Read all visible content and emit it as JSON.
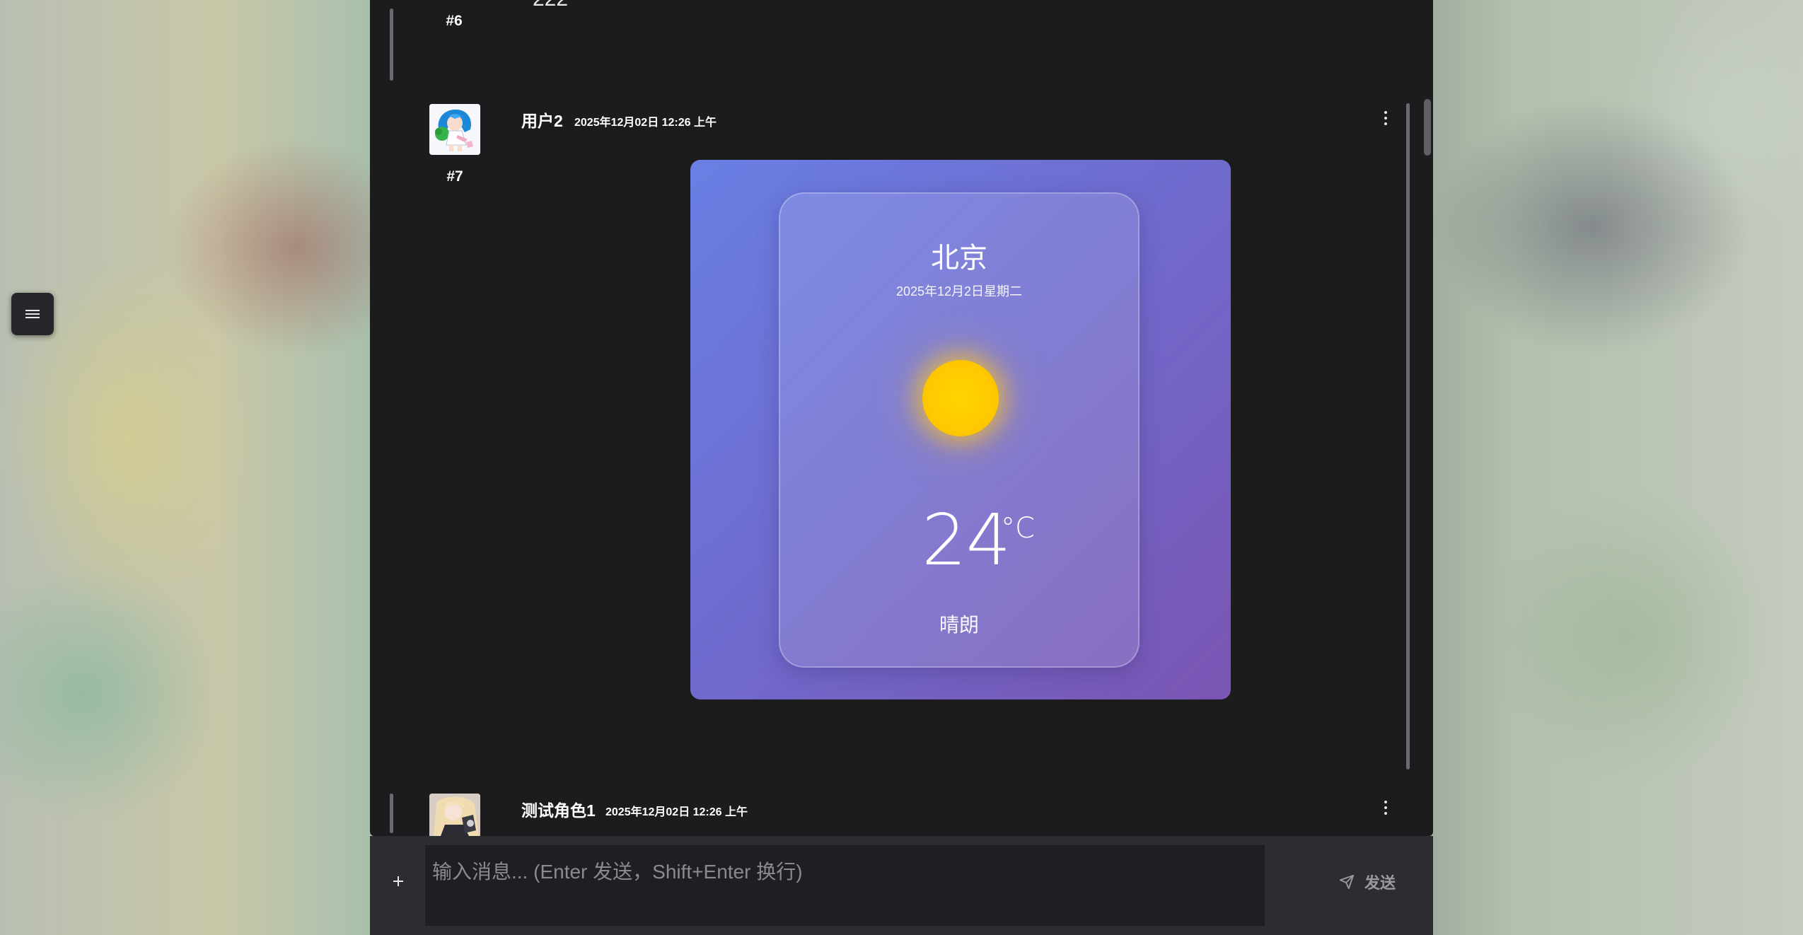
{
  "sidebar": {
    "toggle_icon": "menu-icon"
  },
  "messages": [
    {
      "number": "#6",
      "partial_text": "222"
    },
    {
      "number": "#7",
      "author": "用户2",
      "time": "2025年12月02日 12:26 上午",
      "weather": {
        "city": "北京",
        "date": "2025年12月2日星期二",
        "icon": "sun-icon",
        "temperature": "24",
        "unit": "°C",
        "condition": "晴朗",
        "colors": {
          "gradient_start": "#6a7fe4",
          "gradient_end": "#7a55b3",
          "sun": "#ffcc00"
        }
      }
    },
    {
      "author": "测试角色1",
      "time": "2025年12月02日 12:26 上午"
    }
  ],
  "composer": {
    "placeholder": "输入消息... (Enter 发送，Shift+Enter 换行)",
    "value": "",
    "send_label": "发送",
    "attach_icon": "plus-icon",
    "send_icon": "send-icon"
  },
  "theme": {
    "panel_bg": "#1c1c1f",
    "composer_bg": "#2c2d31",
    "input_bg": "#1e1f23"
  }
}
